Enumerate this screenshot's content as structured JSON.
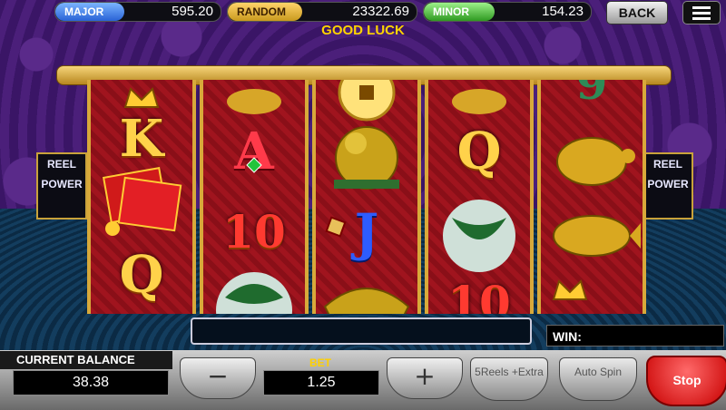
{
  "jackpots": {
    "major": {
      "label": "MAJOR",
      "value": "595.20"
    },
    "random": {
      "label": "RANDOM",
      "value": "23322.69"
    },
    "minor": {
      "label": "MINOR",
      "value": "154.23"
    }
  },
  "nav": {
    "back_label": "BACK",
    "menu_icon": "hamburger-menu-icon"
  },
  "status_message": "GOOD LUCK",
  "reel_power_label": [
    "REEL",
    "POWER"
  ],
  "reels": [
    {
      "symbols": [
        "crown",
        "K",
        "red-envelope",
        "Q"
      ]
    },
    {
      "symbols": [
        "turtle-ornament",
        "A",
        "10",
        "green-bowl"
      ]
    },
    {
      "symbols": [
        "gold-coin",
        "foo-dog",
        "J",
        "dragon"
      ]
    },
    {
      "symbols": [
        "turtle-ornament",
        "Q",
        "green-bowl",
        "10"
      ]
    },
    {
      "symbols": [
        "9",
        "golden-turtle",
        "koi-fish",
        "crown"
      ]
    }
  ],
  "win": {
    "label": "WIN:"
  },
  "balance": {
    "label": "CURRENT BALANCE",
    "value": "38.38"
  },
  "bet": {
    "label": "BET",
    "value": "1.25",
    "minus": "−",
    "plus": "+"
  },
  "controls": {
    "extra_label": "5Reels +Extra",
    "auto_label": "Auto Spin",
    "stop_label": "Stop"
  },
  "colors": {
    "accent_gold": "#ffd24a",
    "reel_red": "#a0141e",
    "stop_red": "#c80000"
  }
}
